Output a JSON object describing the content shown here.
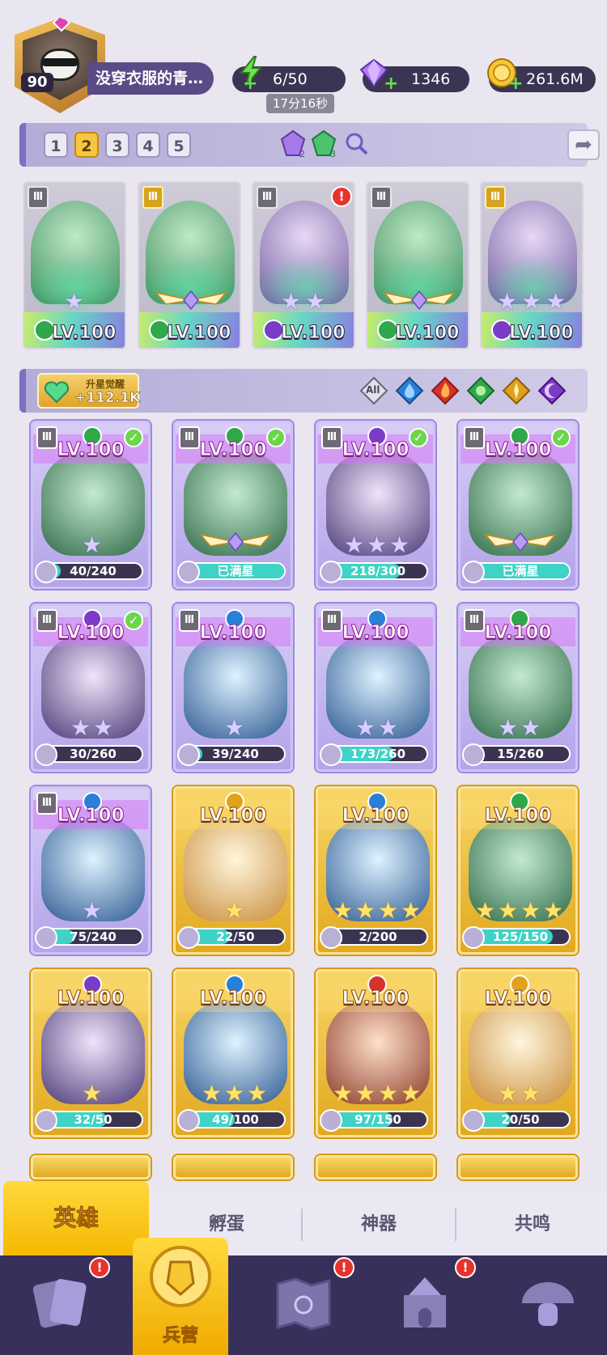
{
  "player": {
    "level": "90",
    "name": "没穿衣服的青…"
  },
  "resources": {
    "energy": "6/50",
    "energy_timer": "17分16秒",
    "gems": "1346",
    "gold": "261.6M"
  },
  "team_tabs": [
    "1",
    "2",
    "3",
    "4",
    "5"
  ],
  "active_team": "2",
  "runes": {
    "purple_count": "2",
    "green_count": "3"
  },
  "team_slots": [
    {
      "rank": "Ⅲ",
      "element": "nature",
      "stars": 1,
      "level": "LV.100",
      "alert": false
    },
    {
      "rank": "Ⅲ",
      "element": "nature",
      "stars": 0,
      "level": "LV.100",
      "alert": false,
      "wings": true
    },
    {
      "rank": "Ⅲ",
      "element": "dark",
      "stars": 2,
      "level": "LV.100",
      "alert": true
    },
    {
      "rank": "Ⅲ",
      "element": "nature",
      "stars": 0,
      "level": "LV.100",
      "alert": false,
      "wings": true
    },
    {
      "rank": "Ⅲ",
      "element": "dark",
      "stars": 3,
      "level": "LV.100",
      "alert": false
    }
  ],
  "awaken": {
    "title": "升星觉醒",
    "value": "+112.1K"
  },
  "filters": {
    "all_label": "All"
  },
  "heroes": [
    {
      "level": "LV.100",
      "progress": "40/240",
      "fill": 0.17,
      "tier": "purple",
      "element": "nature",
      "rank": "Ⅲ",
      "check": true,
      "stars": 1
    },
    {
      "level": "LV.100",
      "progress": "已满星",
      "fill": 1.0,
      "tier": "purple",
      "element": "nature",
      "rank": "Ⅲ",
      "check": true,
      "stars": 0,
      "wings": true
    },
    {
      "level": "LV.100",
      "progress": "218/300",
      "fill": 0.73,
      "tier": "purple",
      "element": "dark",
      "rank": "Ⅲ",
      "check": true,
      "stars": 3
    },
    {
      "level": "LV.100",
      "progress": "已满星",
      "fill": 1.0,
      "tier": "purple",
      "element": "nature",
      "rank": "Ⅲ",
      "check": true,
      "stars": 0,
      "wings": true
    },
    {
      "level": "LV.100",
      "progress": "30/260",
      "fill": 0.12,
      "tier": "purple",
      "element": "dark",
      "rank": "Ⅲ",
      "check": true,
      "stars": 2
    },
    {
      "level": "LV.100",
      "progress": "39/240",
      "fill": 0.16,
      "tier": "purple",
      "element": "water",
      "rank": "Ⅲ",
      "check": false,
      "stars": 1
    },
    {
      "level": "LV.100",
      "progress": "173/260",
      "fill": 0.67,
      "tier": "purple",
      "element": "water",
      "rank": "Ⅲ",
      "check": false,
      "stars": 2
    },
    {
      "level": "LV.100",
      "progress": "15/260",
      "fill": 0.06,
      "tier": "purple",
      "element": "nature",
      "rank": "Ⅲ",
      "check": false,
      "stars": 2
    },
    {
      "level": "LV.100",
      "progress": "75/240",
      "fill": 0.31,
      "tier": "purple",
      "element": "water",
      "rank": "Ⅲ",
      "check": false,
      "stars": 1
    },
    {
      "level": "LV.100",
      "progress": "22/50",
      "fill": 0.44,
      "tier": "gold",
      "element": "light",
      "rank": "",
      "check": false,
      "stars": 1
    },
    {
      "level": "LV.100",
      "progress": "2/200",
      "fill": 0.01,
      "tier": "gold",
      "element": "water",
      "rank": "",
      "check": false,
      "stars": 4
    },
    {
      "level": "LV.100",
      "progress": "125/150",
      "fill": 0.83,
      "tier": "gold",
      "element": "nature",
      "rank": "",
      "check": false,
      "stars": 4
    },
    {
      "level": "LV.100",
      "progress": "32/50",
      "fill": 0.64,
      "tier": "gold",
      "element": "dark",
      "rank": "",
      "check": false,
      "stars": 1
    },
    {
      "level": "LV.100",
      "progress": "49/100",
      "fill": 0.49,
      "tier": "gold",
      "element": "water",
      "rank": "",
      "check": false,
      "stars": 3
    },
    {
      "level": "LV.100",
      "progress": "97/150",
      "fill": 0.65,
      "tier": "gold",
      "element": "fire",
      "rank": "",
      "check": false,
      "stars": 4
    },
    {
      "level": "LV.100",
      "progress": "20/50",
      "fill": 0.4,
      "tier": "gold",
      "element": "light",
      "rank": "",
      "check": false,
      "stars": 2
    }
  ],
  "tabs": [
    "英雄",
    "孵蛋",
    "神器",
    "共鸣"
  ],
  "nav": {
    "active_label": "兵营",
    "items": [
      "cards-icon",
      "barracks-icon",
      "map-icon",
      "castle-icon",
      "mushroom-icon"
    ]
  },
  "colors": {
    "nature": "#2fa84a",
    "dark": "#7a3cc8",
    "water": "#2a7fd8",
    "fire": "#d8322c",
    "light": "#e0a21c",
    "gold_card": "#f2c433",
    "purple_card": "#c3b3ef"
  }
}
